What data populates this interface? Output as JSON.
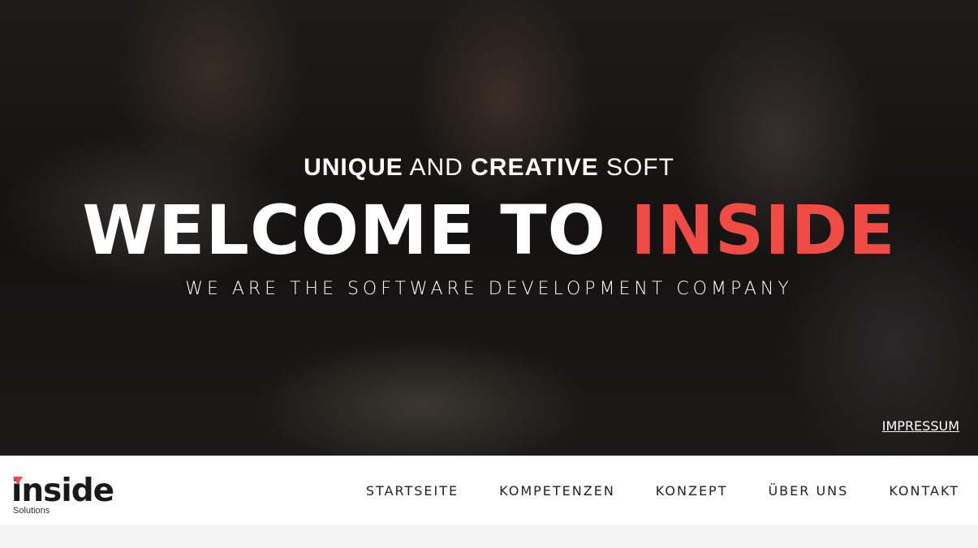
{
  "hero": {
    "tagline": {
      "word1": "UNIQUE",
      "word2": "AND",
      "word3": "CREATIVE",
      "word4": "SOFT"
    },
    "headline": {
      "main": "WELCOME TO ",
      "accent": "INSIDE"
    },
    "subtitle": "WE ARE THE SOFTWARE DEVELOPMENT COMPANY",
    "impressum": "IMPRESSUM"
  },
  "navbar": {
    "logo": {
      "word": "inside",
      "sub": "Solutions"
    },
    "items": [
      {
        "label": "STARTSEITE"
      },
      {
        "label": "KOMPETENZEN"
      },
      {
        "label": "KONZEPT"
      },
      {
        "label": "ÜBER UNS"
      },
      {
        "label": "KONTAKT"
      }
    ]
  },
  "colors": {
    "accent": "#f04b45",
    "nav_bg": "#ffffff",
    "page_bg": "#f4f4f4"
  }
}
